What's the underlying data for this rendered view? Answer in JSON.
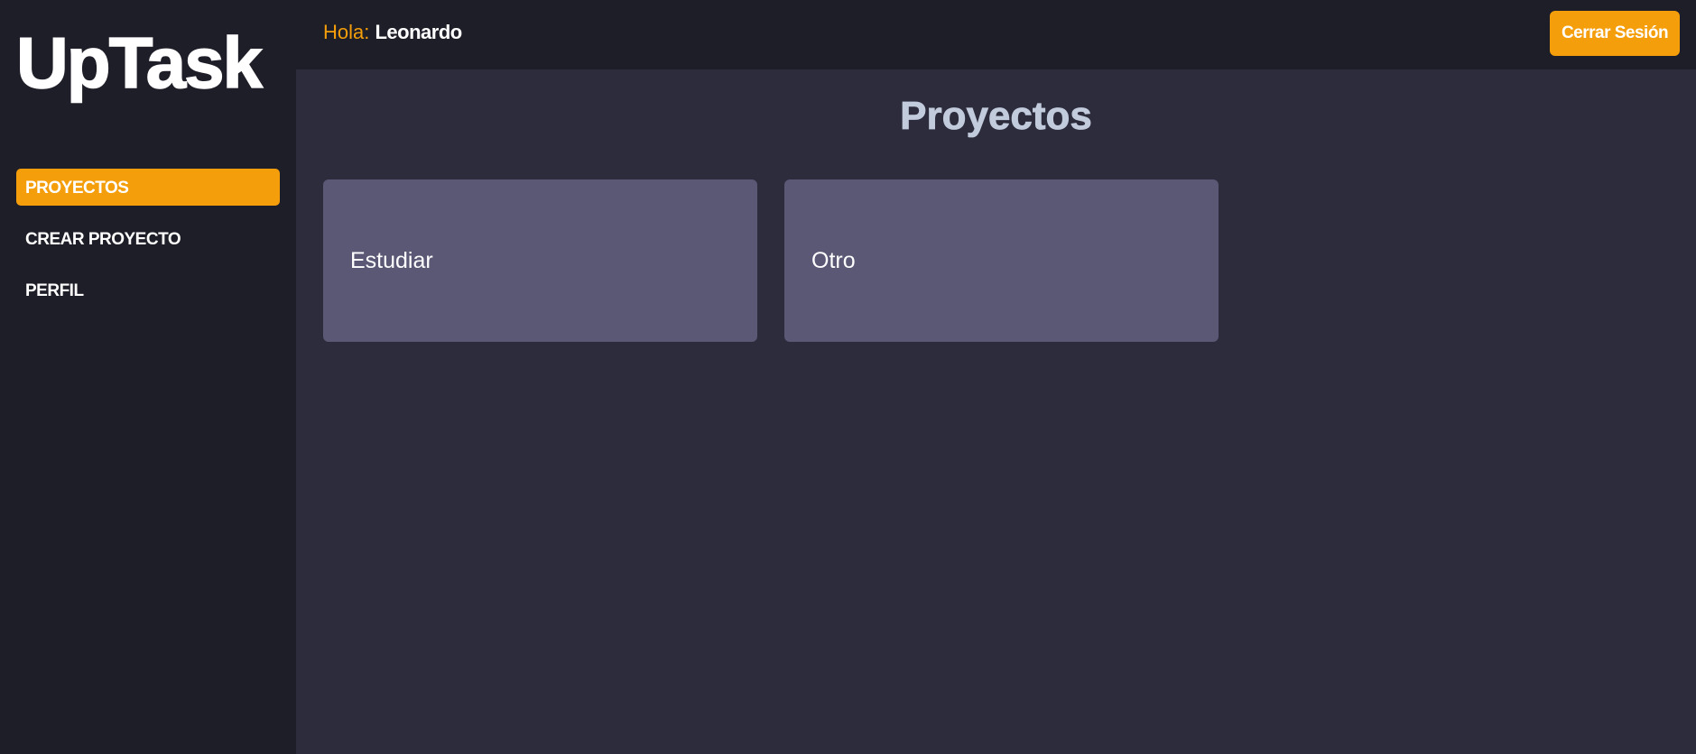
{
  "app": {
    "logo": "UpTask"
  },
  "sidebar": {
    "items": [
      {
        "label": "PROYECTOS",
        "active": true
      },
      {
        "label": "CREAR PROYECTO",
        "active": false
      },
      {
        "label": "PERFIL",
        "active": false
      }
    ]
  },
  "header": {
    "greeting_label": "Hola:",
    "user_name": "Leonardo",
    "logout_label": "Cerrar Sesión"
  },
  "main": {
    "title": "Proyectos",
    "projects": [
      {
        "name": "Estudiar"
      },
      {
        "name": "Otro"
      }
    ]
  },
  "colors": {
    "accent": "#f59e0b",
    "sidebar_bg": "#1e1e28",
    "main_bg": "#2d2c3c",
    "card_bg": "#5a5875",
    "title_color": "#c1cbdc"
  }
}
